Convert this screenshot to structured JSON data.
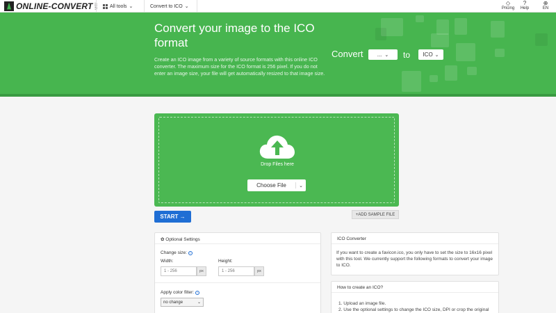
{
  "nav": {
    "logo_text": "ONLINE-CONVERT",
    "logo_small": ".com",
    "all_tools": "All tools",
    "convert_to": "Convert to ICO",
    "pricing": "Pricing",
    "help": "Help",
    "lang": "EN"
  },
  "hero": {
    "title": "Convert your image to the ICO format",
    "description": "Create an ICO image from a variety of source formats with this online ICO converter. The maximum size for the ICO format is 256 pixel. If you do not enter an image size, your file will get automatically resized to that image size.",
    "convert_label": "Convert",
    "from_value": "...",
    "to_label": "to",
    "to_value": "ICO"
  },
  "upload": {
    "drop_text": "Drop Files here",
    "choose_label": "Choose File",
    "start_label": "START →",
    "sample_label": "+ADD SAMPLE FILE"
  },
  "settings": {
    "title": "Optional Settings",
    "change_size": "Change size:",
    "width_label": "Width:",
    "height_label": "Height:",
    "width_placeholder": "1 - 256",
    "height_placeholder": "1 - 256",
    "unit": "px",
    "color_filter_label": "Apply color filter:",
    "color_filter_value": "no change"
  },
  "info": {
    "title": "ICO Converter",
    "text": "If you want to create a favicon.ico, you only have to set the size to 16x16 pixel with this tool. We currently support the following formats to convert your image to ICO.",
    "howto_title": "How to create an ICO?",
    "step1": "1. Upload an image file.",
    "step2": "2. Use the optional settings to change the ICO size, DPI or crop the original"
  },
  "colors": {
    "brand_green": "#47b54f",
    "start_blue": "#1f6ed4"
  }
}
